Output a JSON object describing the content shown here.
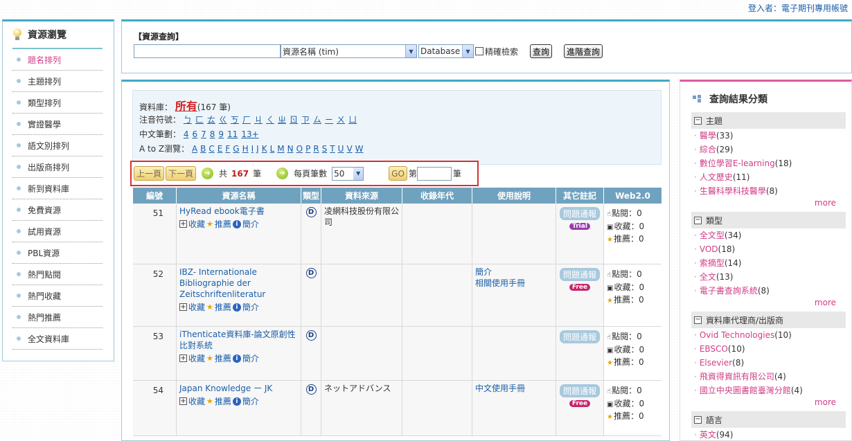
{
  "header": {
    "login_text": "登入者：電子期刊專用帳號"
  },
  "sidebar": {
    "title": "資源瀏覽",
    "items": [
      "題名排列",
      "主題排列",
      "類型排列",
      "實證醫學",
      "語文別排列",
      "出版商排列",
      "新到資料庫",
      "免費資源",
      "試用資源",
      "PBL資源",
      "熱門點閱",
      "熱門收藏",
      "熱門推薦",
      "全文資料庫"
    ],
    "active_index": 0
  },
  "search": {
    "title": "【資源查詢】",
    "keyword_value": "",
    "field_select": "資源名稱 (tim)",
    "type_select": "Database",
    "exact_label": "精確檢索",
    "search_button": "查詢",
    "advanced_button": "進階查詢"
  },
  "filters": {
    "db_label": "資料庫：",
    "db_value": "所有",
    "db_count": "(167 筆)",
    "zhuyin_label": "注音符號：",
    "zhuyin": [
      "ㄅ",
      "ㄈ",
      "ㄊ",
      "ㄍ",
      "ㄎ",
      "ㄏ",
      "ㄐ",
      "ㄑ",
      "ㄓ",
      "ㄖ",
      "ㄗ",
      "ㄙ",
      "ㄧ",
      "ㄨ",
      "ㄩ"
    ],
    "strokes_label": "中文筆劃：",
    "strokes": [
      "4",
      "6",
      "7",
      "8",
      "9",
      "11",
      "13+"
    ],
    "az_label": "A to Z瀏覽：",
    "az": [
      "A",
      "B",
      "C",
      "E",
      "F",
      "G",
      "H",
      "I",
      "J",
      "K",
      "L",
      "M",
      "N",
      "O",
      "P",
      "R",
      "S",
      "T",
      "U",
      "V",
      "W"
    ]
  },
  "pager": {
    "prev": "上一頁",
    "next": "下一頁",
    "total_prefix": "共",
    "total": "167",
    "total_suffix": "筆",
    "per_page_label": "每頁筆數",
    "per_page": "50",
    "go": "GO",
    "page_prefix": "第",
    "page_value": "",
    "page_suffix": "筆"
  },
  "table": {
    "headers": [
      "編號",
      "資源名稱",
      "類型",
      "資料來源",
      "收錄年代",
      "使用說明",
      "其它註記",
      "Web2.0"
    ],
    "action_labels": {
      "collect": "收藏",
      "recommend": "推薦",
      "intro": "簡介"
    },
    "report_label": "問題通報",
    "stat_labels": {
      "clicks": "點閱：",
      "collects": "收藏：",
      "recommends": "推薦："
    },
    "rows": [
      {
        "no": "51",
        "title": "HyRead ebook電子書",
        "type": "D",
        "source": "凌網科技股份有限公司",
        "years": "",
        "help": [],
        "tag": "Trial",
        "clicks": "0",
        "collects": "0",
        "recommends": "0"
      },
      {
        "no": "52",
        "title": "IBZ- Internationale Bibliographie der Zeitschriftenliteratur",
        "type": "D",
        "source": "",
        "years": "",
        "help": [
          "簡介",
          "相關使用手冊"
        ],
        "tag": "Free",
        "clicks": "0",
        "collects": "0",
        "recommends": "0"
      },
      {
        "no": "53",
        "title": "iThenticate資料庫-論文原創性比對系統",
        "type": "D",
        "source": "",
        "years": "",
        "help": [],
        "tag": "",
        "clicks": "0",
        "collects": "0",
        "recommends": "0"
      },
      {
        "no": "54",
        "title": "Japan Knowledge ー JK",
        "type": "D",
        "source": "ネットアドバンス",
        "years": "",
        "help": [
          "中文使用手冊"
        ],
        "tag": "Free",
        "clicks": "0",
        "collects": "0",
        "recommends": "0"
      }
    ]
  },
  "facets": {
    "title": "查詢結果分類",
    "more_label": "more",
    "groups": [
      {
        "name": "主題",
        "items": [
          {
            "name": "醫學",
            "count": "(33)"
          },
          {
            "name": "綜合",
            "count": "(29)"
          },
          {
            "name": "數位學習E-learning",
            "count": "(18)"
          },
          {
            "name": "人文歷史",
            "count": "(11)"
          },
          {
            "name": "生醫科學科技醫學",
            "count": "(8)"
          }
        ]
      },
      {
        "name": "類型",
        "items": [
          {
            "name": "全文型",
            "count": "(34)"
          },
          {
            "name": "VOD",
            "count": "(18)"
          },
          {
            "name": "索摘型",
            "count": "(14)"
          },
          {
            "name": "全文",
            "count": "(13)"
          },
          {
            "name": "電子書查詢系統",
            "count": "(8)"
          }
        ]
      },
      {
        "name": "資料庫代理商/出版商",
        "items": [
          {
            "name": "Ovid Technologies",
            "count": "(10)"
          },
          {
            "name": "EBSCO",
            "count": "(10)"
          },
          {
            "name": "Elsevier",
            "count": "(8)"
          },
          {
            "name": "飛資得資訊有限公司",
            "count": "(4)"
          },
          {
            "name": "國立中央圖書館臺灣分館",
            "count": "(4)"
          }
        ]
      },
      {
        "name": "語言",
        "items": [
          {
            "name": "英文",
            "count": "(94)"
          }
        ]
      }
    ]
  }
}
